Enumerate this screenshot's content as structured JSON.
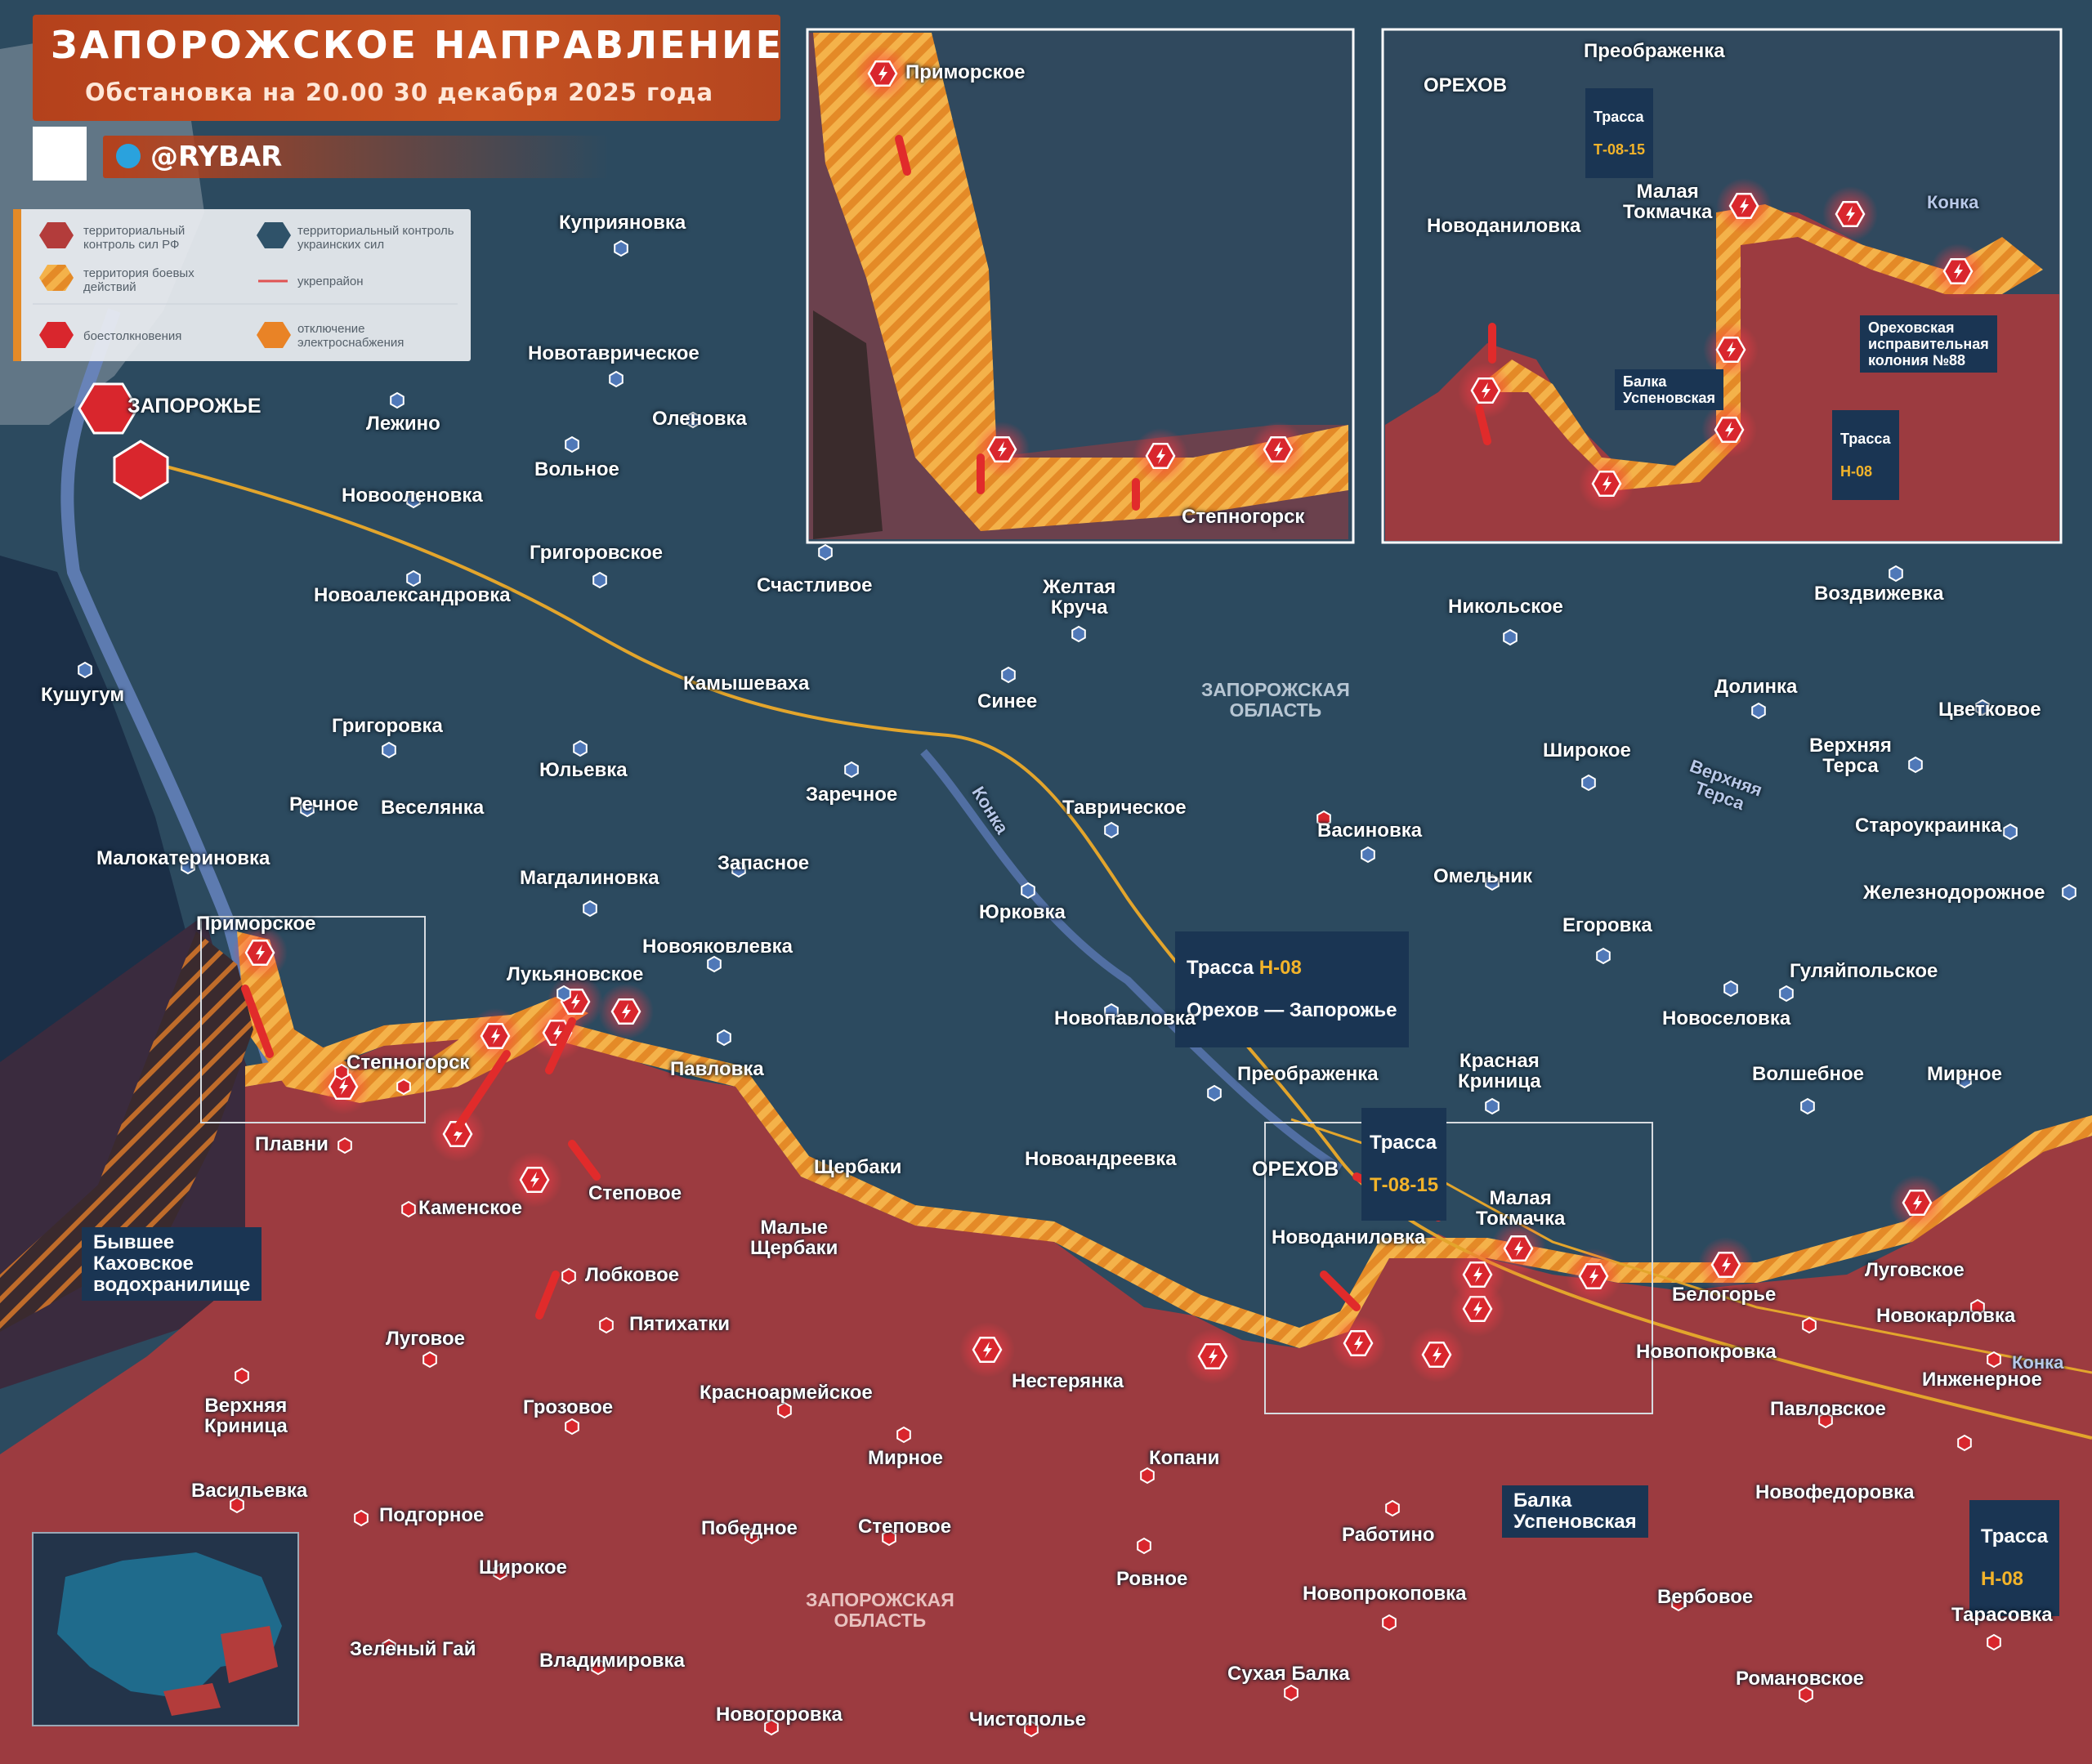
{
  "header": {
    "title": "ЗАПОРОЖСКОЕ НАПРАВЛЕНИЕ",
    "subtitle": "Обстановка на 20.00 30 декабря 2025 года",
    "brand": "@RYBAR"
  },
  "legend": {
    "items": [
      {
        "label": "территориальный контроль сил РФ",
        "color": "#b33c3b"
      },
      {
        "label": "территориальный контроль украинских сил",
        "color": "#2f5269"
      },
      {
        "label": "территория боевых действий",
        "color": "#e48a27"
      },
      {
        "label": "укрепрайон",
        "color": "#e05353"
      },
      {
        "label": "боестолкновения",
        "color": "#d9262d"
      },
      {
        "label": "отключение электроснабжения",
        "color": "#e98326"
      }
    ]
  },
  "colors": {
    "ua_control": "#2c4a5f",
    "ru_control": "#9c3b40",
    "combat_zone": "#e48a27",
    "clash_marker": "#d9262d",
    "water": "#5b78b4",
    "road": "#e3a52c",
    "callout_bg": "#1a3553"
  },
  "icons": {
    "clash": "explosion-icon",
    "ua_settlement": "ua-settlement-icon",
    "ru_settlement": "ru-settlement-icon",
    "city": "city-icon",
    "telegram": "telegram-icon",
    "qr": "qr-code-icon"
  },
  "regions": {
    "ua_oblast": "ЗАПОРОЖСКАЯ\nОБЛАСТЬ",
    "ru_oblast": "ЗАПОРОЖСКАЯ\nОБЛАСТЬ"
  },
  "callouts": {
    "h08_main": {
      "line1_prefix": "Трасса ",
      "line1_code": "Н-08",
      "line2": "Орехов — Запорожье"
    },
    "t0815_main": {
      "line1": "Трасса",
      "line2": "Т-08-15"
    },
    "kakhovka": "Бывшее\nКаховское\nводохранилище",
    "balka_main": "Балка\nУспеновская",
    "h08_right": {
      "line1": "Трасса",
      "line2": "Н-08"
    },
    "inset_t0815": {
      "line1": "Трасса",
      "line2": "Т-08-15"
    },
    "inset_colony": "Ореховская\nисправительная\nколония №88",
    "inset_balka": "Балка\nУспеновская",
    "inset_h08": {
      "line1": "Трасса",
      "line2": "Н-08"
    }
  },
  "labels": {
    "zaporozhye": "ЗАПОРОЖЬЕ",
    "orekhov": "ОРЕХОВ",
    "kuprianovka": "Куприяновка",
    "novotavricheskoe": "Новотаврическое",
    "lezhino": "Лежино",
    "olenovka": "Оленовка",
    "volnoe": "Вольное",
    "novoolenovka": "Новооленовка",
    "grigorovskoe": "Григоровское",
    "novoaleksandrovka": "Новоалександровка",
    "schastlivoe": "Счастливое",
    "zheltaya_krucha": "Желтая\nКруча",
    "kushugum": "Кушугум",
    "kamyshevakha": "Камышеваха",
    "sinee": "Синее",
    "grigorovka": "Григоровка",
    "yulyevka": "Юльевка",
    "zarechnoe": "Заречное",
    "rechnoe": "Речное",
    "veselyanka": "Веселянка",
    "tavricheskoe": "Таврическое",
    "malokaterinovka": "Малокатериновка",
    "zapasnoe": "Запасное",
    "magdalinovka": "Магдалиновка",
    "yurkovka": "Юрковка",
    "primorskoe": "Приморское",
    "novoyakovlevka": "Новояковлевка",
    "lukyanovskoe": "Лукьяновское",
    "novopavlovka": "Новопавловка",
    "stepnogorsk": "Степногорск",
    "pavlovka": "Павловка",
    "preobrazhenka": "Преображенка",
    "krasnaya_krinitsa": "Красная\nКриница",
    "plavni": "Плавни",
    "stepovoe": "Степовое",
    "scherbaki": "Щербаки",
    "novoandreevka": "Новоандреевка",
    "kamenskoe": "Каменское",
    "malye_scherbaki": "Малые\nЩербаки",
    "novodanilovka": "Новоданиловка",
    "malaya_tokmachka": "Малая\nТокмачка",
    "lobkovoe": "Лобковое",
    "pyatikhatki": "Пятихатки",
    "lugovoe_w": "Луговое",
    "nesteryanka": "Нестерянка",
    "krasnoarmeyskoe": "Красноармейское",
    "grozovoe": "Грозовое",
    "verkhnyaya_krinitsa": "Верхняя\nКриница",
    "mirnoe_s": "Мирное",
    "kopani": "Копани",
    "vasilyevka": "Васильевка",
    "podgornoe": "Подгорное",
    "pobednoe": "Победное",
    "stepovoe_s": "Степовое",
    "rabotino": "Работино",
    "shirokoe_s": "Широкое",
    "rovnoe": "Ровное",
    "novoprokopovka": "Новопрокоповка",
    "verbovoe": "Вербовое",
    "zeleny_gay": "Зеленый Гай",
    "vladimirovka": "Владимировка",
    "sukhaya_balka": "Сухая Балка",
    "tarasovka": "Тарасовка",
    "romanovskoe": "Романовское",
    "novogorovka": "Новогоровка",
    "chistopole": "Чистополье",
    "nikolskoe": "Никольское",
    "vozdvizhevka": "Воздвижевка",
    "dolinka": "Долинка",
    "tsvetkovoe": "Цветковое",
    "shirokoe_n": "Широкое",
    "verkhnyaya_tersa": "Верхняя\nТерса",
    "staroukrainka": "Староукраинка",
    "vasinovka": "Васиновка",
    "omelnik": "Омельник",
    "zheleznodorozhnoe": "Железнодорожное",
    "egorovka": "Егоровка",
    "gulyaypolskoe": "Гуляйпольское",
    "novoselovka": "Новоселовка",
    "volshebnoe": "Волшебное",
    "mirnoe_e": "Мирное",
    "lugovskoe": "Луговское",
    "belogorye": "Белогорье",
    "novokarlovka": "Новокарловка",
    "novopokrovka": "Новопокровка",
    "inzhenernoe": "Инженерное",
    "pavlovskoe": "Павловское",
    "novofedorovka": "Новофедоровка",
    "river_konka_c": "Конка",
    "river_konka_e": "Конка",
    "river_tersa": "Верхняя\nТерса",
    "inset1_primorskoe": "Приморское",
    "inset1_stepnogorsk": "Степногорск",
    "inset2_preobrazhenka": "Преображенка",
    "inset2_orekhov": "ОРЕХОВ",
    "inset2_novodanilovka": "Новоданиловка",
    "inset2_malaya_tokmachka": "Малая\nТокмачка",
    "inset2_konka": "Конка"
  }
}
